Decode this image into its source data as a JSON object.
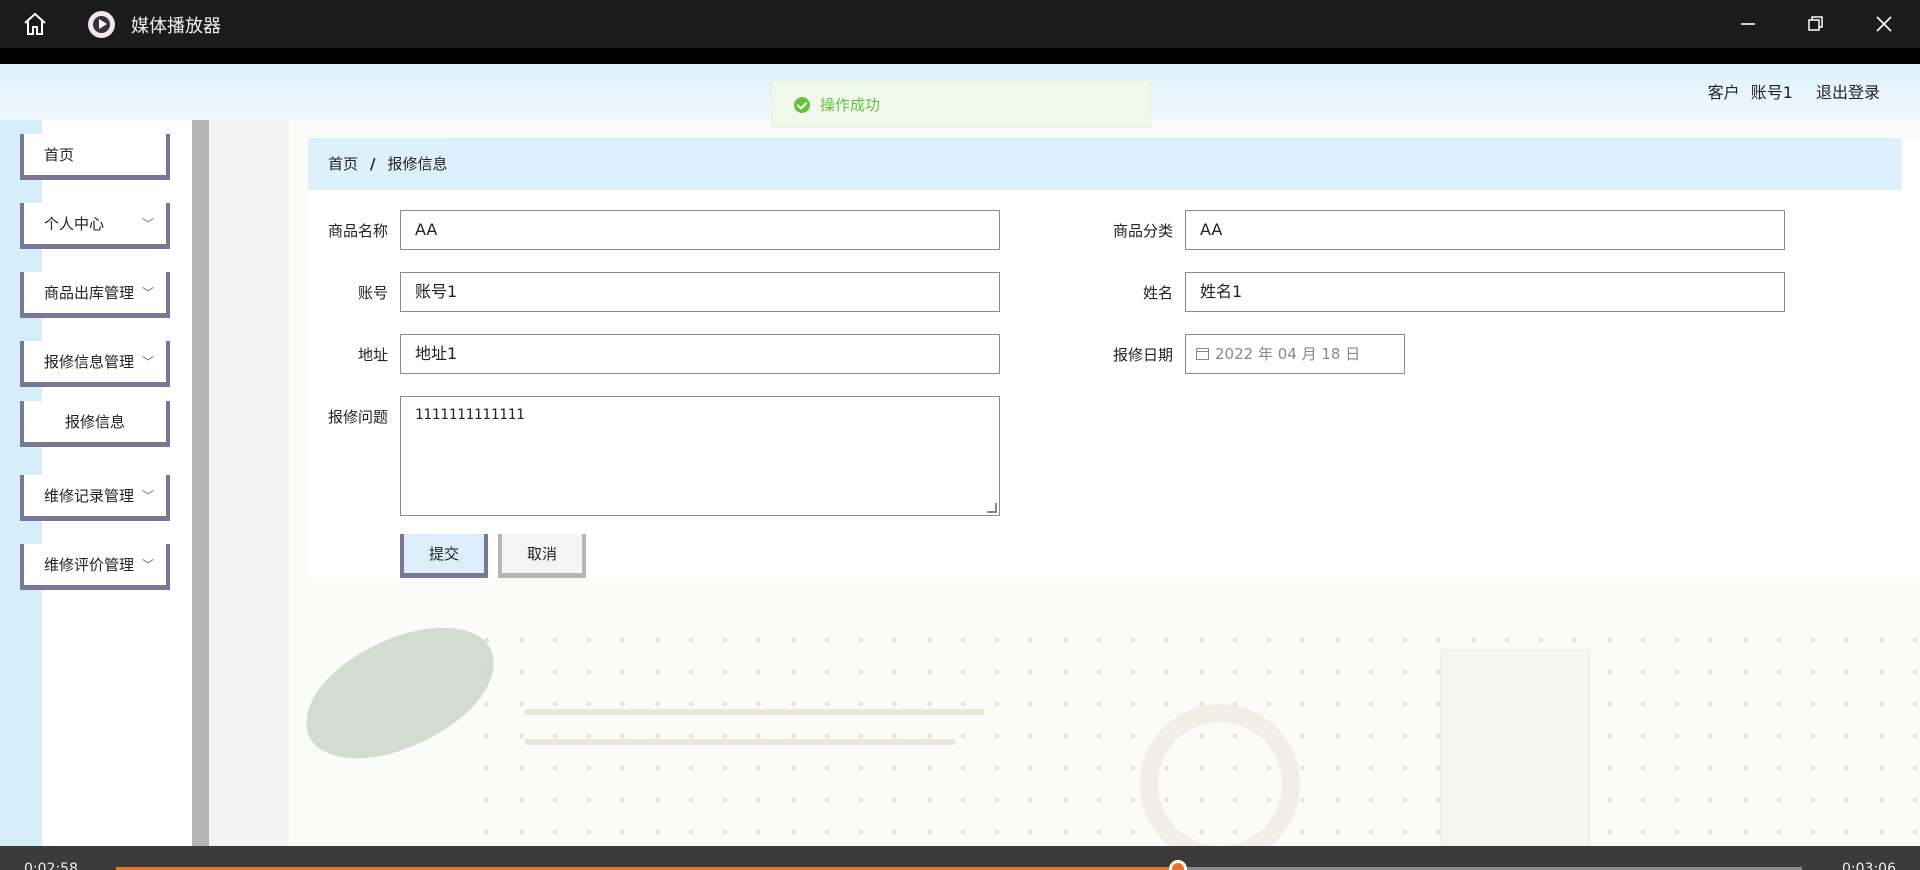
{
  "player": {
    "app_name": "媒体播放器",
    "time_elapsed": "0:02:58",
    "time_total": "0:03:06",
    "progress": 0.63
  },
  "site": {
    "title": "",
    "user_role": "客户",
    "user_account": "账号1",
    "logout": "退出登录"
  },
  "toast": {
    "message": "操作成功"
  },
  "sidebar": {
    "items": [
      {
        "label": "首页"
      },
      {
        "label": "个人中心"
      },
      {
        "label": "商品出库管理"
      },
      {
        "label": "报修信息管理"
      },
      {
        "label": "报修信息"
      },
      {
        "label": "维修记录管理"
      },
      {
        "label": "维修评价管理"
      }
    ]
  },
  "breadcrumb": {
    "home": "首页",
    "sep": "/",
    "current": "报修信息"
  },
  "form": {
    "product_name_label": "商品名称",
    "product_name_value": "AA",
    "product_category_label": "商品分类",
    "product_category_value": "AA",
    "account_label": "账号",
    "account_value": "账号1",
    "name_label": "姓名",
    "name_value": "姓名1",
    "address_label": "地址",
    "address_value": "地址1",
    "repair_date_label": "报修日期",
    "repair_date_value": "2022 年 04 月 18 日",
    "repair_issue_label": "报修问题",
    "repair_issue_value": "1111111111111",
    "submit": "提交",
    "cancel": "取消"
  },
  "colors": {
    "accent": "#7a7698",
    "progress": "#e8742a",
    "success": "#67c23a",
    "crumb_bg": "#dcf1fb"
  }
}
